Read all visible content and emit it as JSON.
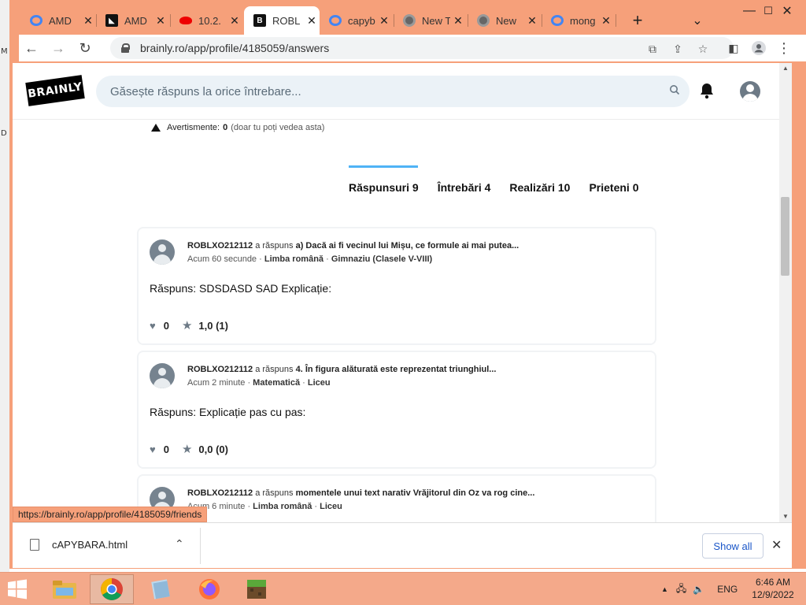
{
  "desktop": {
    "left_labels": [
      "M",
      "D"
    ]
  },
  "browser": {
    "window_controls": {
      "minimize": "—",
      "maximize": "☐",
      "close": "✕"
    },
    "tabs": [
      {
        "title": "AMD",
        "icon": "google-icon"
      },
      {
        "title": "AMD",
        "icon": "amd-icon"
      },
      {
        "title": "10.2.",
        "icon": "redhat-icon"
      },
      {
        "title": "ROBL",
        "icon": "brainly-icon",
        "active": true
      },
      {
        "title": "capyb",
        "icon": "google-icon"
      },
      {
        "title": "New T",
        "icon": "chrome-icon"
      },
      {
        "title": "New",
        "icon": "chrome-icon"
      },
      {
        "title": "mong",
        "icon": "google-icon"
      }
    ],
    "new_tab": "+",
    "tab_search": "⌄",
    "url": "brainly.ro/app/profile/4185059/answers"
  },
  "page": {
    "search_placeholder": "Găsește răspuns la orice întrebare...",
    "logo_text": "BRAINLY",
    "warning": {
      "label": "Avertismente:",
      "count": "0",
      "note": "(doar tu poți vedea asta)"
    },
    "profile_tabs": [
      {
        "label": "Răspunsuri 9",
        "active": true
      },
      {
        "label": "Întrebări 4"
      },
      {
        "label": "Realizări 10"
      },
      {
        "label": "Prieteni 0"
      }
    ],
    "answers": [
      {
        "user": "ROBLXO212112",
        "verb": "a răspuns",
        "question": "a) Dacă ai fi vecinul lui Mișu, ce formule ai mai putea...",
        "time": "Acum 60 secunde",
        "subject": "Limba română",
        "level": "Gimnaziu (Clasele V-VIII)",
        "body": "Răspuns: SDSDASD SAD Explicație:",
        "likes": "0",
        "rating": "1,0 (1)"
      },
      {
        "user": "ROBLXO212112",
        "verb": "a răspuns",
        "question": "4. În figura alăturată este reprezentat triunghiul...",
        "time": "Acum 2 minute",
        "subject": "Matematică",
        "level": "Liceu",
        "body": "Răspuns: Explicație pas cu pas:",
        "likes": "0",
        "rating": "0,0 (0)"
      },
      {
        "user": "ROBLXO212112",
        "verb": "a răspuns",
        "question": "momentele unui text narativ Vrăjitorul din Oz va rog cine...",
        "time": "Acum 6 minute",
        "subject": "Limba română",
        "level": "Liceu",
        "body": "",
        "likes": "",
        "rating": ""
      }
    ],
    "separator": "·"
  },
  "status_url": "https://brainly.ro/app/profile/4185059/friends",
  "download": {
    "filename": "cAPYBARA.html",
    "show_all": "Show all"
  },
  "taskbar": {
    "lang": "ENG",
    "time": "6:46 AM",
    "date": "12/9/2022"
  }
}
